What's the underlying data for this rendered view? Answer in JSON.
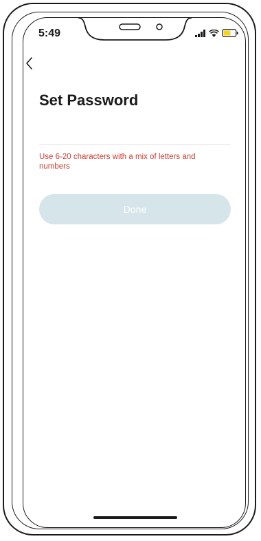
{
  "status_bar": {
    "time": "5:49",
    "icons": [
      "signal-icon",
      "wifi-icon",
      "battery-icon"
    ],
    "battery_color": "#f5d31c"
  },
  "nav": {
    "back_icon": "chevron-left-icon"
  },
  "page": {
    "title": "Set Password",
    "password_value": "",
    "hint": "Use 6-20 characters with a mix of letters and numbers",
    "done_label": "Done"
  },
  "colors": {
    "hint": "#cc3b33",
    "button_disabled": "#d6e5e9",
    "text": "#1a1a1a"
  }
}
